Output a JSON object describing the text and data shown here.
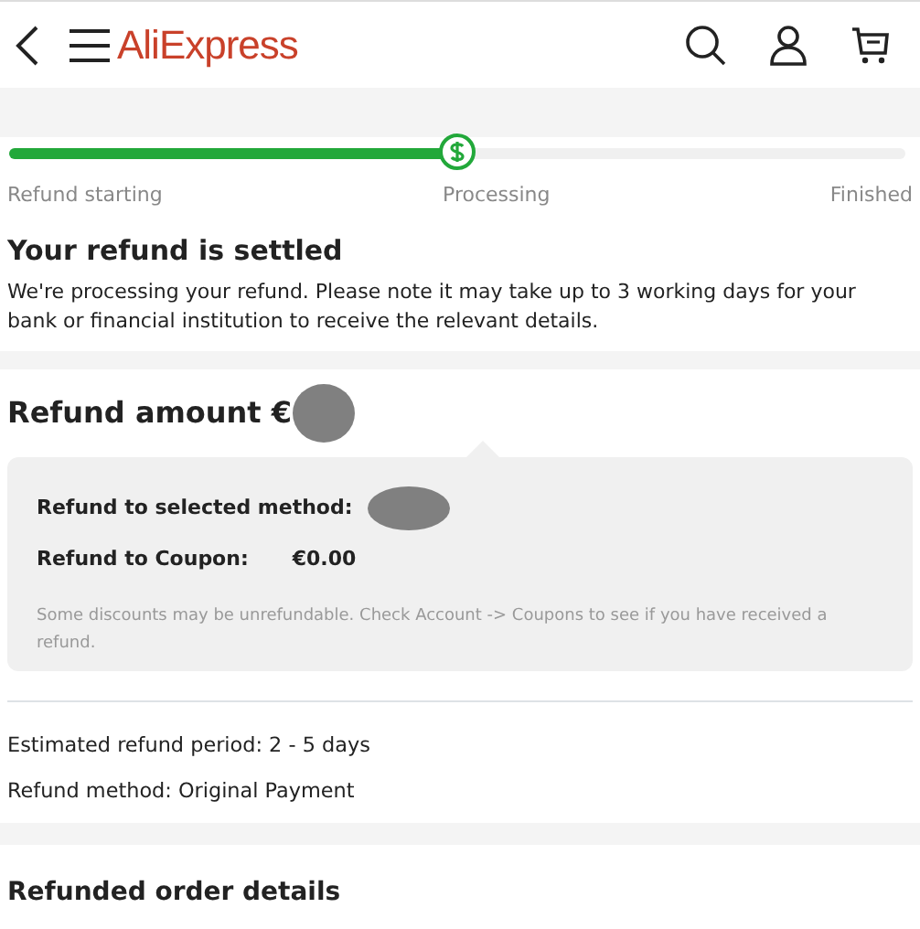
{
  "header": {
    "logo": "AliExpress"
  },
  "progress": {
    "level": 0.5,
    "steps": [
      {
        "label": "Refund starting"
      },
      {
        "label": "Processing"
      },
      {
        "label": "Finished"
      }
    ]
  },
  "status": {
    "title": "Your refund is settled",
    "message": "We're processing your refund. Please note it may take up to 3 working days for your bank or financial institution to receive the relevant details."
  },
  "refund": {
    "title": "Refund amount €",
    "lines": [
      {
        "label": "Refund to selected method:",
        "value_redacted": true
      },
      {
        "label": "Refund to Coupon:",
        "value": "€0.00",
        "value_redacted": false
      }
    ],
    "note": "Some discounts may be unrefundable. Check Account -> Coupons to see if you have received a refund.",
    "details": [
      "Estimated refund period: 2 - 5 days",
      "Refund method: Original Payment"
    ]
  },
  "order_details": {
    "title": "Refunded order details"
  }
}
